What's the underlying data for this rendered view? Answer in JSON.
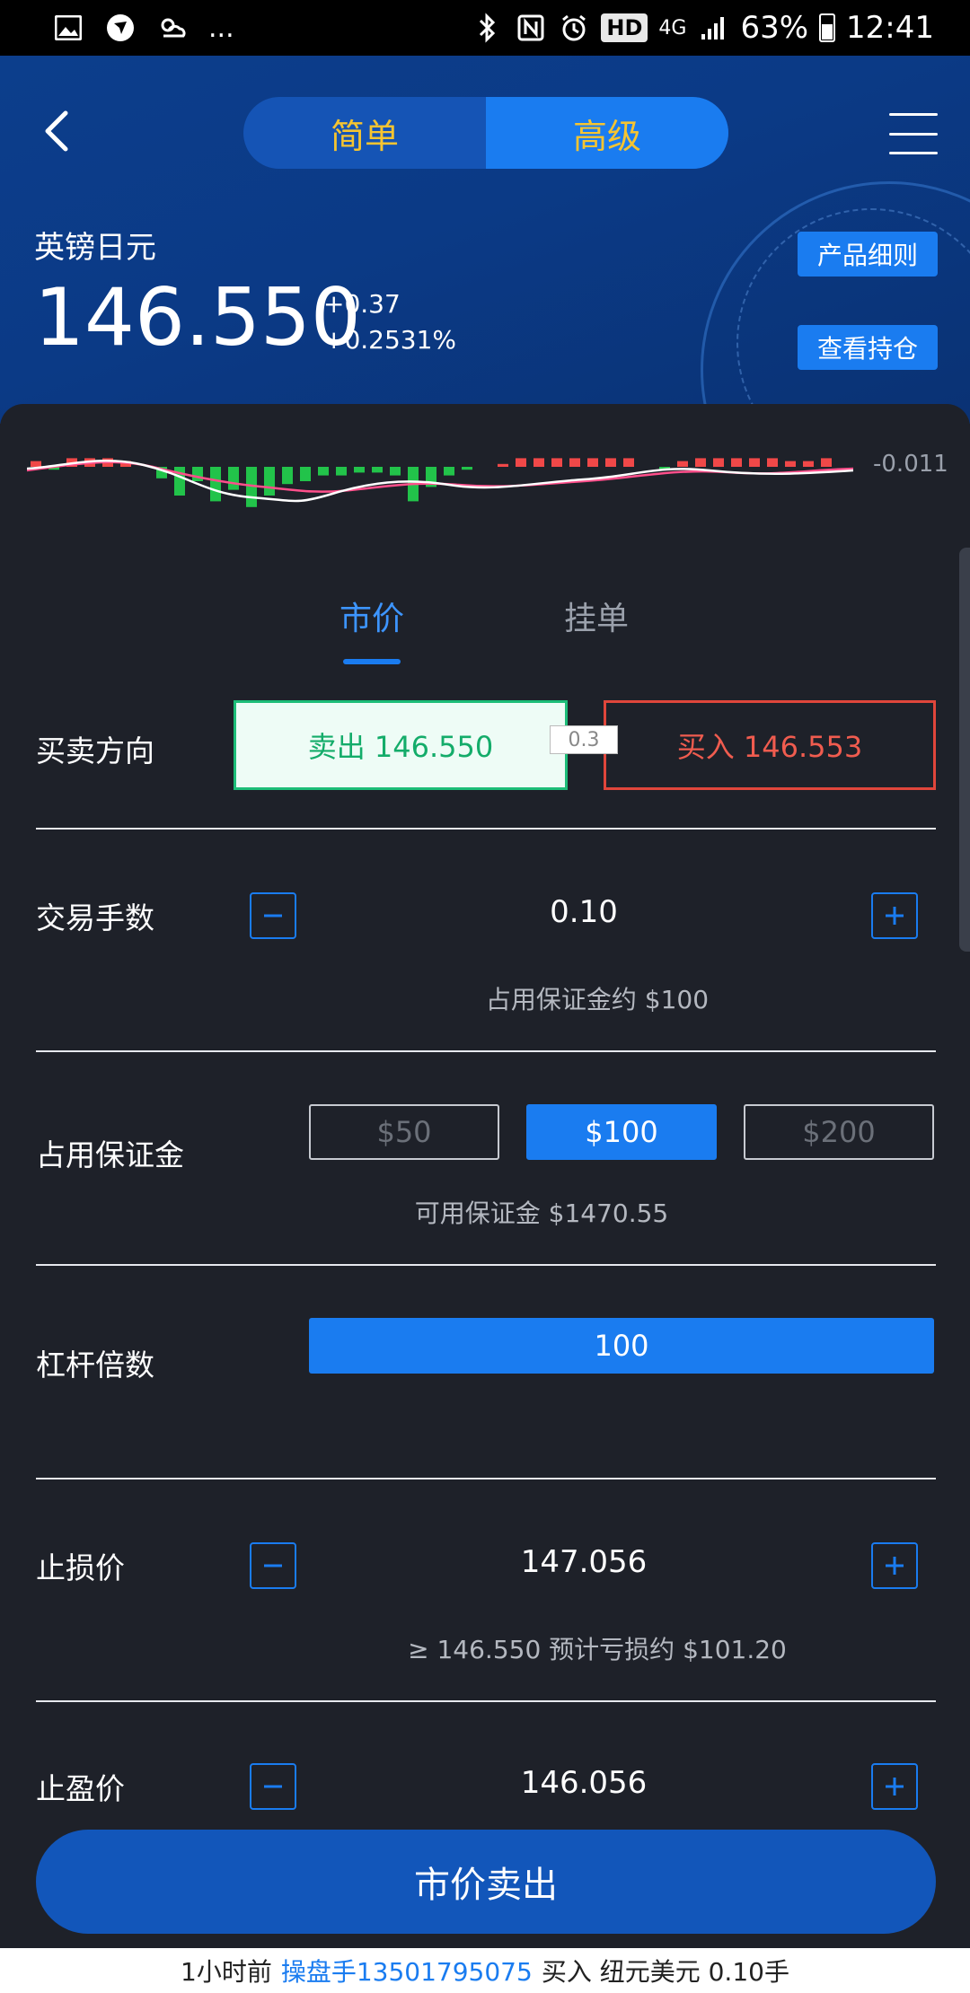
{
  "status_bar": {
    "left_more": "...",
    "hd": "HD",
    "network": "4G",
    "battery": "63%",
    "time": "12:41"
  },
  "header": {
    "segments": [
      "简单",
      "高级"
    ],
    "active_segment": 1,
    "pair_name": "英镑日元",
    "price": "146.550",
    "change_abs": "+0.37",
    "change_pct": "+0.2531%",
    "btn_product_rules": "产品细则",
    "btn_positions": "查看持仓"
  },
  "sparkline": {
    "value_label": "-0.011"
  },
  "order_tabs": [
    "市价",
    "挂单"
  ],
  "direction": {
    "label": "买卖方向",
    "sell": "卖出 146.550",
    "buy": "买入 146.553",
    "spread": "0.3"
  },
  "lots": {
    "label": "交易手数",
    "value": "0.10",
    "hint": "占用保证金约 $100"
  },
  "margin": {
    "label": "占用保证金",
    "options": [
      "$50",
      "$100",
      "$200"
    ],
    "active_index": 1,
    "hint": "可用保证金 $1470.55"
  },
  "leverage": {
    "label": "杠杆倍数",
    "value": "100"
  },
  "stop_loss": {
    "label": "止损价",
    "value": "147.056",
    "hint": "≥ 146.550 预计亏损约 $101.20"
  },
  "take_profit": {
    "label": "止盈价",
    "value": "146.056"
  },
  "submit_label": "市价卖出",
  "ticker": {
    "prefix": "1小时前",
    "user": "操盘手13501795075",
    "action": "买入 纽元美元 0.10手"
  },
  "colors": {
    "accent": "#1a7cf0",
    "sell_green": "#14ac6a",
    "buy_red": "#f05c4f",
    "header_bg": "#0c3e8c",
    "panel_bg": "#1e2129"
  }
}
